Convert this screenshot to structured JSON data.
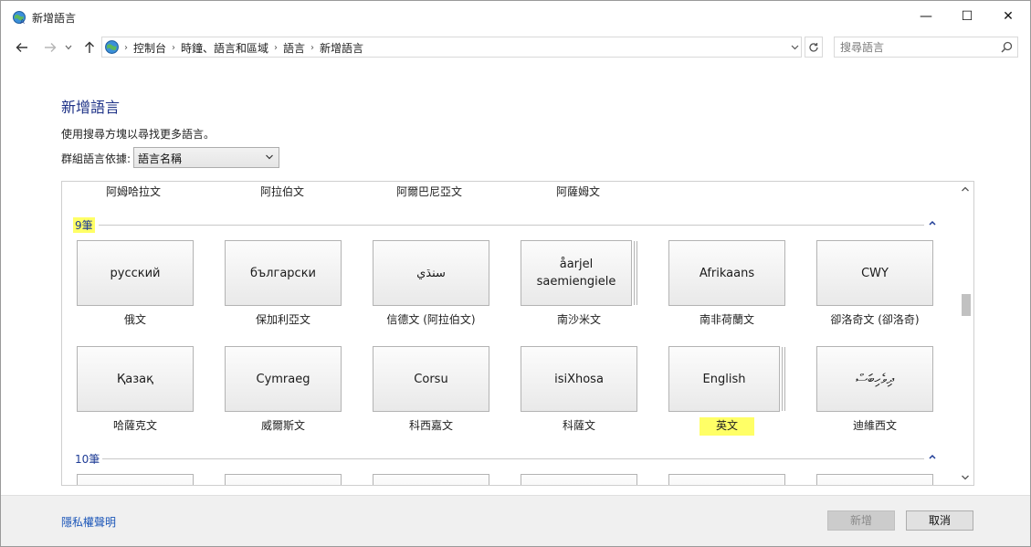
{
  "window": {
    "title": "新增語言",
    "minimize_glyph": "—",
    "maximize_glyph": "☐",
    "close_glyph": "✕"
  },
  "nav": {
    "back_icon": "arrow-left-icon",
    "forward_icon": "arrow-right-icon",
    "up_icon": "arrow-up-icon",
    "breadcrumbs": [
      "控制台",
      "時鐘、語言和區域",
      "語言",
      "新增語言"
    ],
    "search_placeholder": "搜尋語言"
  },
  "page": {
    "title": "新增語言",
    "hint": "使用搜尋方塊以尋找更多語言。",
    "group_label": "群組語言依據:",
    "group_value": "語言名稱"
  },
  "previous_row": [
    "阿姆哈拉文",
    "阿拉伯文",
    "阿爾巴尼亞文",
    "阿薩姆文"
  ],
  "sections": [
    {
      "title": "9筆",
      "tiles": [
        {
          "native": "русский",
          "name": "俄文"
        },
        {
          "native": "български",
          "name": "保加利亞文"
        },
        {
          "native": "سنڌي",
          "name": "信德文 (阿拉伯文)"
        },
        {
          "native": "åarjel saemiengiele",
          "name": "南沙米文"
        },
        {
          "native": "Afrikaans",
          "name": "南非荷蘭文"
        },
        {
          "native": "CWY",
          "name": "卻洛奇文 (卻洛奇)"
        },
        {
          "native": "Қазақ",
          "name": "哈薩克文"
        },
        {
          "native": "Cymraeg",
          "name": "威爾斯文"
        },
        {
          "native": "Corsu",
          "name": "科西嘉文"
        },
        {
          "native": "isiXhosa",
          "name": "科薩文"
        },
        {
          "native": "English",
          "name": "英文"
        },
        {
          "native": "ދިވެހިބަސް",
          "name": "迪維西文"
        }
      ]
    },
    {
      "title": "10筆",
      "tiles": []
    }
  ],
  "footer": {
    "privacy_link": "隱私權聲明",
    "add_button": "新增",
    "cancel_button": "取消"
  },
  "highlight_color": "#ffff66",
  "accent_color": "#1e3287"
}
